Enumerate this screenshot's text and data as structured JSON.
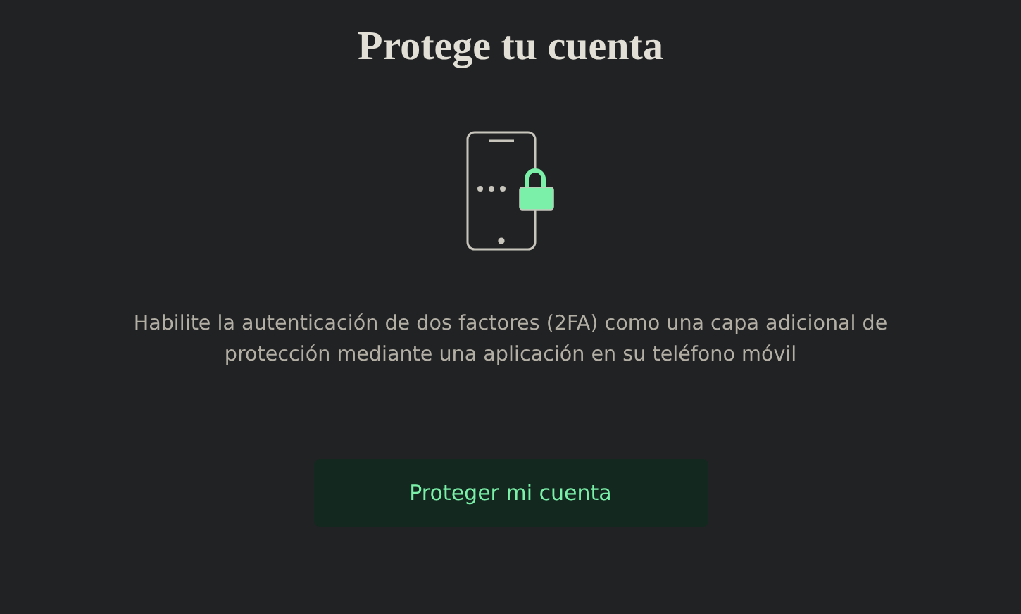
{
  "title": "Protege tu cuenta",
  "description": "Habilite la autenticación de dos factores (2FA) como una capa adicional de protección mediante una aplicación en su teléfono móvil",
  "button": {
    "label": "Proteger mi cuenta"
  }
}
